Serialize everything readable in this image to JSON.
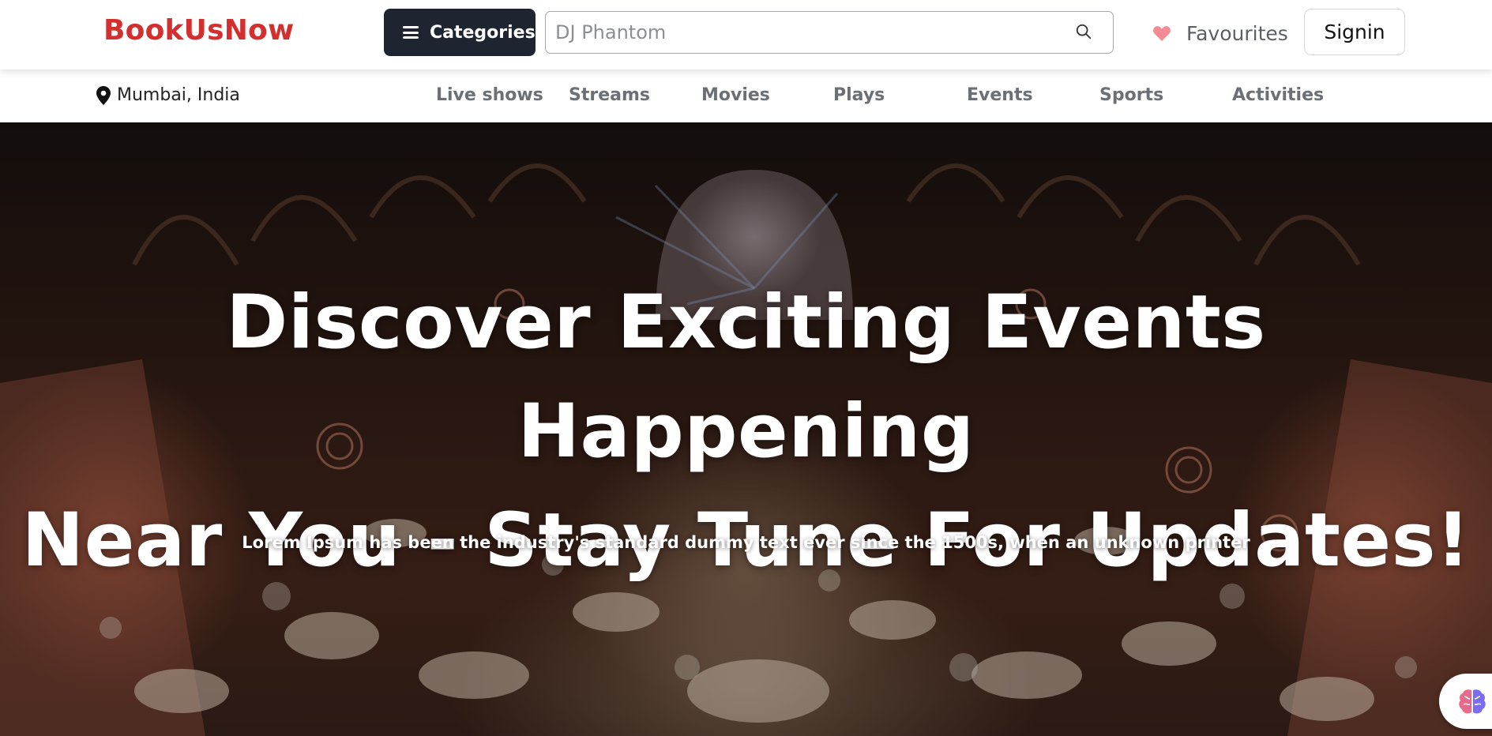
{
  "header": {
    "logo": "BookUsNow",
    "categories_label": "Categories",
    "search": {
      "value": "",
      "placeholder": "DJ Phantom"
    },
    "favourites_label": "Favourites",
    "signin_label": "Signin"
  },
  "subnav": {
    "location": "Mumbai, India",
    "items": [
      {
        "label": "Live shows"
      },
      {
        "label": "Streams"
      },
      {
        "label": "Movies"
      },
      {
        "label": "Plays"
      },
      {
        "label": "Events"
      },
      {
        "label": "Sports"
      },
      {
        "label": "Activities"
      }
    ]
  },
  "hero": {
    "title_line1": "Discover Exciting Events Happening",
    "title_line2": "Near You - Stay Tune For Updates!",
    "subtitle": "Lorem Ipsum has been the industry's standard dummy text ever since the 1500s, when an unknown printer"
  },
  "colors": {
    "brand": "#d32f2f",
    "categories_bg": "#1e2430",
    "heart": "#f28b94",
    "nav_text": "#6b6f76"
  },
  "icons": {
    "menu": "hamburger-icon",
    "search": "search-icon",
    "favourite": "heart-icon",
    "location": "map-pin-icon",
    "assistant": "brain-icon"
  }
}
